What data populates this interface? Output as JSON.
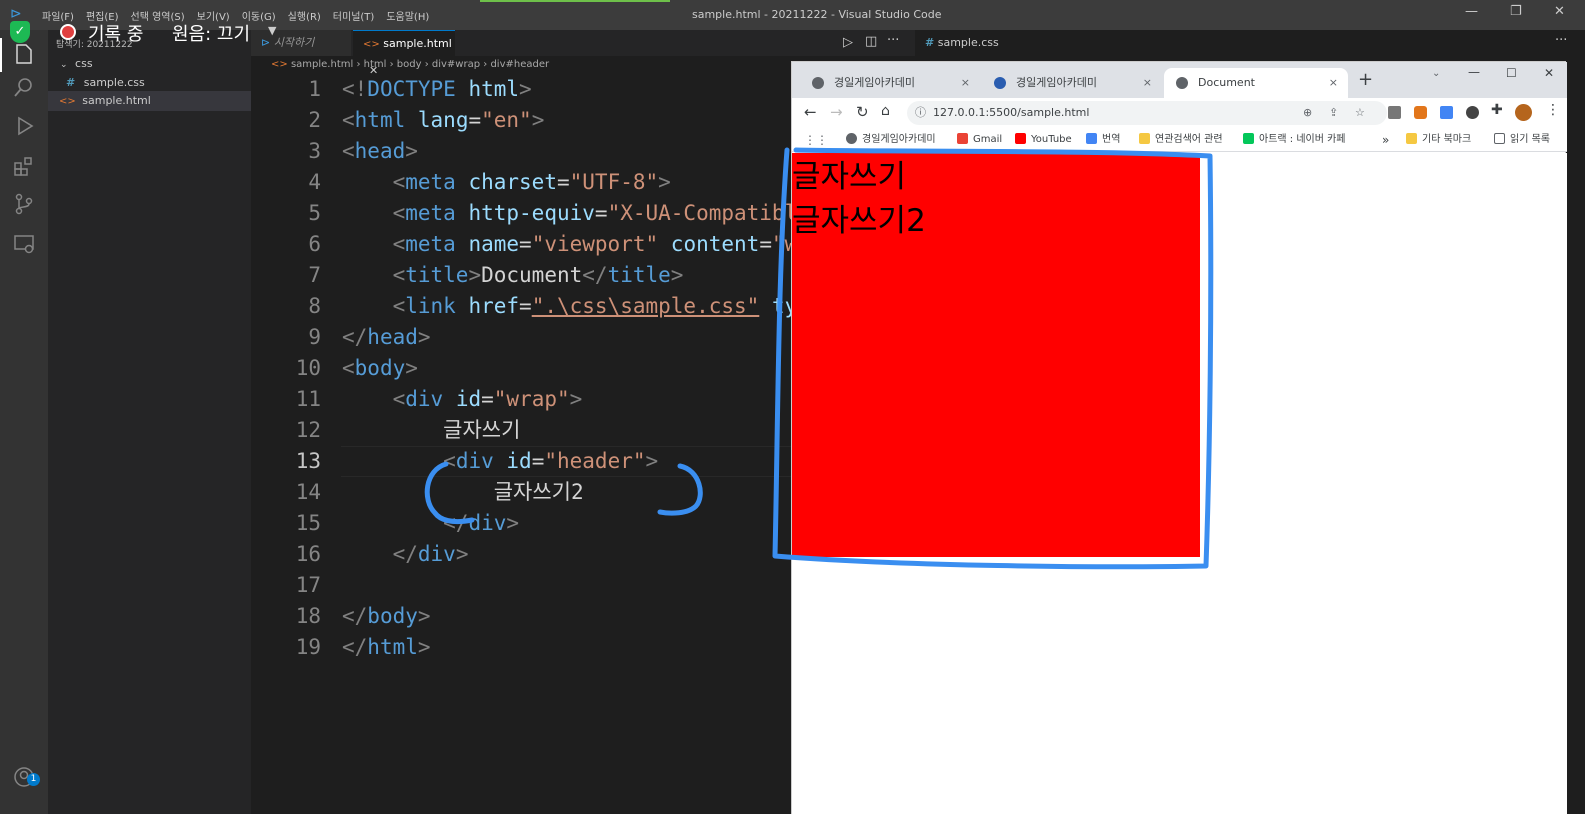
{
  "vscode": {
    "menu": [
      "파일(F)",
      "편집(E)",
      "선택 영역(S)",
      "보기(V)",
      "이동(G)",
      "실행(R)",
      "터미널(T)",
      "도움말(H)"
    ],
    "window_title": "sample.html - 20211222 - Visual Studio Code",
    "explorer_header": "탐색기: 20211222",
    "tree": {
      "folder": "css",
      "css_file": "sample.css",
      "html_file": "sample.html"
    },
    "tabs": {
      "start": "시작하기",
      "active": "sample.html",
      "right": "sample.css"
    },
    "breadcrumb": [
      "sample.html",
      "html",
      "body",
      "div#wrap",
      "div#header"
    ],
    "accent_color": "#007acc"
  },
  "recorder": {
    "status": "기록 중",
    "audio": "원음: 끄기"
  },
  "code_lines": [
    {
      "n": "1"
    },
    {
      "n": "2"
    },
    {
      "n": "3"
    },
    {
      "n": "4"
    },
    {
      "n": "5"
    },
    {
      "n": "6"
    },
    {
      "n": "7"
    },
    {
      "n": "8"
    },
    {
      "n": "9"
    },
    {
      "n": "10"
    },
    {
      "n": "11"
    },
    {
      "n": "12"
    },
    {
      "n": "13"
    },
    {
      "n": "14"
    },
    {
      "n": "15"
    },
    {
      "n": "16"
    },
    {
      "n": "17"
    },
    {
      "n": "18"
    },
    {
      "n": "19"
    }
  ],
  "code": {
    "l1": [
      "<!",
      "DOCTYPE",
      " html",
      ">"
    ],
    "l2_attr": "lang",
    "l2_val": "\"en\"",
    "l4_attr": "charset",
    "l4_val": "\"UTF-8\"",
    "l5_attr": "http-equiv",
    "l5_val": "\"X-UA-Compatibl",
    "l6_attr1": "name",
    "l6_val1": "\"viewport\"",
    "l6_attr2": "content",
    "l6_val2": "\"w",
    "l7_text": "Document",
    "l8_attr": "href",
    "l8_val": "\".\\css\\sample.css\"",
    "l8_rest": "ty",
    "l11_attr": "id",
    "l11_val": "\"wrap\"",
    "l12_text": "글자쓰기",
    "l13_attr": "id",
    "l13_val": "\"header\"",
    "l14_text": "글자쓰기2"
  },
  "browser": {
    "tabs": [
      {
        "label": "경일게임아카데미",
        "close": "×"
      },
      {
        "label": "경일게임아카데미",
        "close": "×"
      },
      {
        "label": "Document",
        "close": "×"
      }
    ],
    "new_tab": "+",
    "url": "127.0.0.1:5500/sample.html",
    "bookmarks": [
      "경일게임아카데미",
      "Gmail",
      "YouTube",
      "번역",
      "연관검색어 관련",
      "아트랙 : 네이버 카페",
      "»",
      "기타 북마크",
      "읽기 목록"
    ],
    "page_text": [
      "글자쓰기",
      "글자쓰기2"
    ],
    "wrap_color": "#ff0000"
  },
  "annotation_color": "#3a8ef0",
  "notification_count": "1"
}
